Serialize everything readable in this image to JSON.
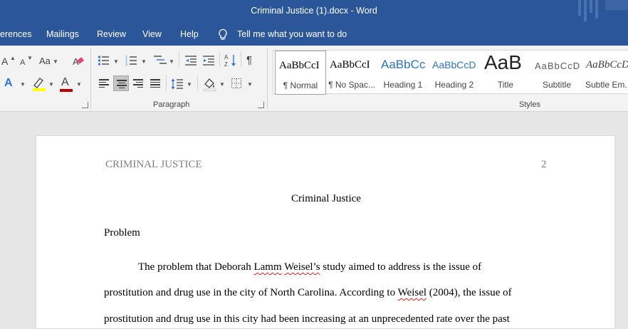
{
  "window": {
    "title": "Criminal Justice (1).docx  -  Word"
  },
  "tabs": [
    {
      "label": "erences"
    },
    {
      "label": "Mailings"
    },
    {
      "label": "Review"
    },
    {
      "label": "View"
    },
    {
      "label": "Help"
    }
  ],
  "tell_me": {
    "label": "Tell me what you want to do"
  },
  "ribbon": {
    "font_group": {
      "grow_font": "A",
      "shrink_font": "A",
      "change_case": "Aa",
      "text_effects": "A",
      "font_color": "A",
      "highlight_color": "#ffff00",
      "font_color_value": "#c00000"
    },
    "paragraph_group": {
      "label": "Paragraph",
      "show_marks": "¶"
    },
    "styles_group": {
      "label": "Styles",
      "items": [
        {
          "preview": "AaBbCcI",
          "name": "¶ Normal"
        },
        {
          "preview": "AaBbCcI",
          "name": "¶ No Spac..."
        },
        {
          "preview": "AaBbCc",
          "name": "Heading 1"
        },
        {
          "preview": "AaBbCcD",
          "name": "Heading 2"
        },
        {
          "preview": "AaB",
          "name": "Title"
        },
        {
          "preview": "AaBbCcD",
          "name": "Subtitle"
        },
        {
          "preview": "AaBbCcD",
          "name": "Subtle Em..."
        }
      ]
    }
  },
  "document": {
    "header_left": "CRIMINAL JUSTICE",
    "header_right": "2",
    "title": "Criminal Justice",
    "heading": "Problem",
    "line1": {
      "a": "The problem that Deborah ",
      "b": "Lamm",
      "c": " ",
      "d": "Weisel’s",
      "e": " study aimed to address is the issue of"
    },
    "line2": {
      "a": "prostitution and drug use in the city of North Carolina. According to ",
      "b": "Weisel",
      "c": " (2004), the issue of"
    },
    "line3": "prostitution and drug use in this city had been increasing at an unprecedented rate over the past"
  }
}
